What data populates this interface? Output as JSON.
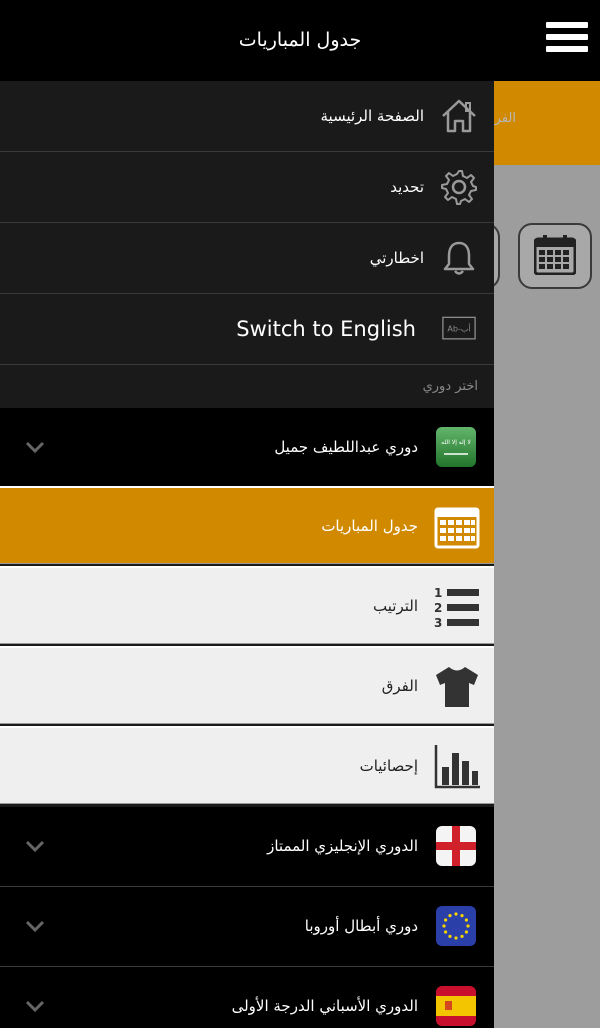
{
  "header": {
    "title": "جدول المباريات",
    "menu_icon": "hamburger-icon"
  },
  "background": {
    "partial_text": "الفر"
  },
  "menu": [
    {
      "label": "الصفحة الرئيسية",
      "icon": "home-icon"
    },
    {
      "label": "تحديد",
      "icon": "gear-icon"
    },
    {
      "label": "اخطارتي",
      "icon": "bell-icon"
    },
    {
      "label": "Switch to English",
      "icon": "language-icon",
      "icon_text": "Ab-أب"
    }
  ],
  "section_label": "اختر دوري",
  "leagues": [
    {
      "label": "دوري عبداللطيف جميل",
      "icon": "saudi-flag-icon",
      "flag_text": "لا إله إلا الله"
    },
    {
      "label": "الدوري الإنجليزي الممتاز",
      "icon": "england-flag-icon"
    },
    {
      "label": "دوري أبطال أوروبا",
      "icon": "eu-flag-icon"
    },
    {
      "label": "الدوري الأسباني الدرجة الأولى",
      "icon": "spain-flag-icon"
    }
  ],
  "submenu": [
    {
      "label": "جدول المباريات",
      "icon": "calendar-icon",
      "active": true
    },
    {
      "label": "الترتيب",
      "icon": "ranking-list-icon",
      "icon_numbers": [
        "1",
        "2",
        "3"
      ]
    },
    {
      "label": "الفرق",
      "icon": "shirt-icon"
    },
    {
      "label": "إحصائيات",
      "icon": "bar-chart-icon"
    }
  ],
  "colors": {
    "accent": "#d18a00",
    "drawer_bg": "#1a1a1a",
    "league_bg": "#000000",
    "submenu_bg": "#efefef"
  }
}
